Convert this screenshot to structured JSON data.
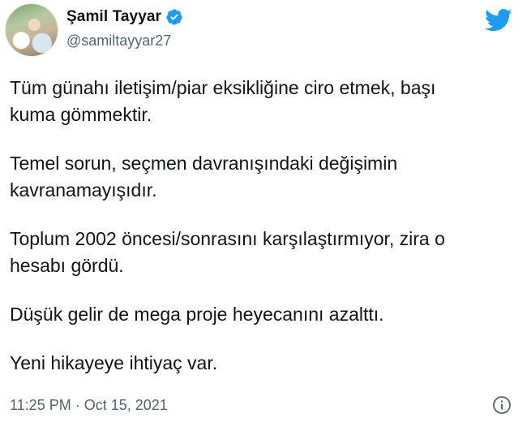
{
  "user": {
    "display_name": "Şamil Tayyar",
    "handle": "@samiltayyar27",
    "verified": true,
    "avatar_icon": "profile-photo"
  },
  "brand": {
    "logo_icon": "twitter-bird-icon",
    "accent_color": "#1d9bf0"
  },
  "tweet": {
    "paragraphs": [
      "Tüm günahı iletişim/piar eksikliğine ciro etmek, başı\nkuma gömmektir.",
      "Temel sorun, seçmen davranışındaki değişimin\nkavranamayışıdır.",
      "Toplum 2002 öncesi/sonrasını karşılaştırmıyor, zira o\nhesabı gördü.",
      "Düşük gelir de mega proje heyecanını azalttı.",
      "Yeni hikayeye ihtiyaç var."
    ],
    "timestamp": "11:25 PM · Oct 15, 2021",
    "info_icon": "info-icon"
  }
}
